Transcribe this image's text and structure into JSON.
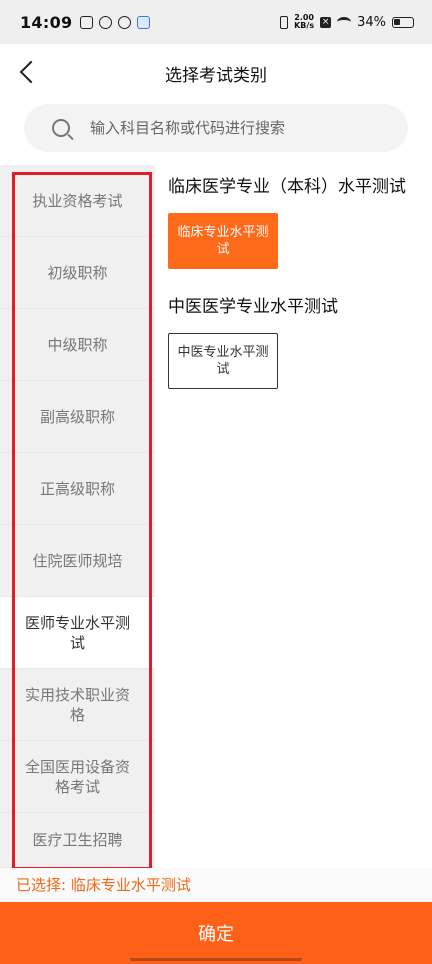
{
  "status_bar": {
    "time": "14:09",
    "net_speed_value": "2.00",
    "net_speed_unit": "KB/s",
    "battery": "34%"
  },
  "header": {
    "title": "选择考试类别"
  },
  "search": {
    "placeholder": "输入科目名称或代码进行搜索"
  },
  "sidebar": {
    "items": [
      {
        "label": "执业资格考试"
      },
      {
        "label": "初级职称"
      },
      {
        "label": "中级职称"
      },
      {
        "label": "副高级职称"
      },
      {
        "label": "正高级职称"
      },
      {
        "label": "住院医师规培"
      },
      {
        "label": "医师专业水平测试"
      },
      {
        "label": "实用技术职业资格"
      },
      {
        "label": "全国医用设备资格考试"
      },
      {
        "label": "医疗卫生招聘"
      }
    ],
    "active_index": 6
  },
  "content": {
    "sections": [
      {
        "title": "临床医学专业（本科）水平测试",
        "option": "临床专业水平测试"
      },
      {
        "title": "中医医学专业水平测试",
        "option": "中医专业水平测试"
      }
    ]
  },
  "footer": {
    "selected_text": "已选择: 临床专业水平测试",
    "confirm_label": "确定"
  },
  "colors": {
    "accent": "#ff6118",
    "selected_text": "#ef6a18",
    "highlight_frame": "#e01d2a"
  }
}
